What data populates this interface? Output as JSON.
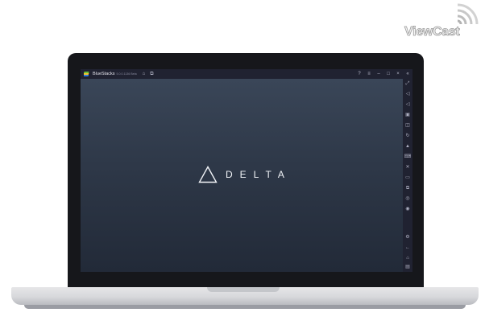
{
  "watermark": {
    "text": "ViewCast"
  },
  "app": {
    "title": "BlueStacks",
    "version": "5.0.0.1136 Beta",
    "beta": "",
    "tabs": [
      {
        "icon": "home-icon"
      },
      {
        "icon": "multi-instance-icon"
      }
    ],
    "window_controls": [
      {
        "icon": "help-icon",
        "glyph": "?"
      },
      {
        "icon": "menu-icon",
        "glyph": "≡"
      },
      {
        "icon": "minimize-icon",
        "glyph": "–"
      },
      {
        "icon": "maximize-icon",
        "glyph": "□"
      },
      {
        "icon": "close-icon",
        "glyph": "×"
      },
      {
        "icon": "collapse-sidebar-icon",
        "glyph": "«"
      }
    ]
  },
  "splash": {
    "brand": "DELTA"
  },
  "sidebar": {
    "icons": [
      "fullscreen-icon",
      "volume-up-icon",
      "volume-down-icon",
      "screen-record-icon",
      "screenshot-icon",
      "rotate-icon",
      "shake-icon",
      "keyboard-controls-icon",
      "game-controls-icon",
      "media-folder-icon",
      "multi-instance-sync-icon",
      "eco-mode-icon",
      "macro-icon",
      "settings-icon",
      "back-icon",
      "home-nav-icon",
      "recent-apps-icon"
    ]
  }
}
